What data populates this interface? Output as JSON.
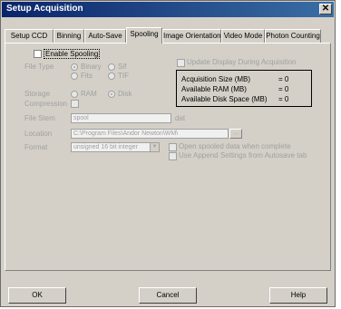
{
  "window": {
    "title": "Setup Acquisition",
    "close_glyph": "✕"
  },
  "tabs": [
    {
      "label": "Setup CCD"
    },
    {
      "label": "Binning"
    },
    {
      "label": "Auto-Save"
    },
    {
      "label": "Spooling"
    },
    {
      "label": "Image Orientation"
    },
    {
      "label": "Video Mode"
    },
    {
      "label": "Photon Counting"
    }
  ],
  "spooling": {
    "enable_label": "Enable Spooling",
    "file_type_label": "File Type",
    "file_types": [
      {
        "label": "Binary",
        "selected": true
      },
      {
        "label": "Sif",
        "selected": false
      },
      {
        "label": "Fits",
        "selected": false
      },
      {
        "label": "TIF",
        "selected": false
      }
    ],
    "storage_label": "Storage",
    "storage_options": [
      {
        "label": "RAM",
        "selected": false
      },
      {
        "label": "Disk",
        "selected": true
      }
    ],
    "compression_label": "Compression",
    "update_display_label": "Update Display During Acquisition",
    "info": {
      "acq_size_label": "Acquisition Size (MB)",
      "acq_size_value": "= 0",
      "ram_label": "Available RAM (MB)",
      "ram_value": "= 0",
      "disk_label": "Available Disk Space (MB)",
      "disk_value": "= 0"
    },
    "file_stem_label": "File Stem",
    "file_stem_value": "spool",
    "file_ext": "dat",
    "location_label": "Location",
    "location_value": "C:\\Program Files\\Andor Newton\\WM\\",
    "browse_label": "...",
    "format_label": "Format",
    "format_value": "unsigned 16 bit integer",
    "format_arrow": "▼",
    "open_spooled_label": "Open spooled data when complete",
    "use_append_label": "Use Append Settings from Autosave tab"
  },
  "buttons": {
    "ok": "OK",
    "cancel": "Cancel",
    "help": "Help"
  }
}
